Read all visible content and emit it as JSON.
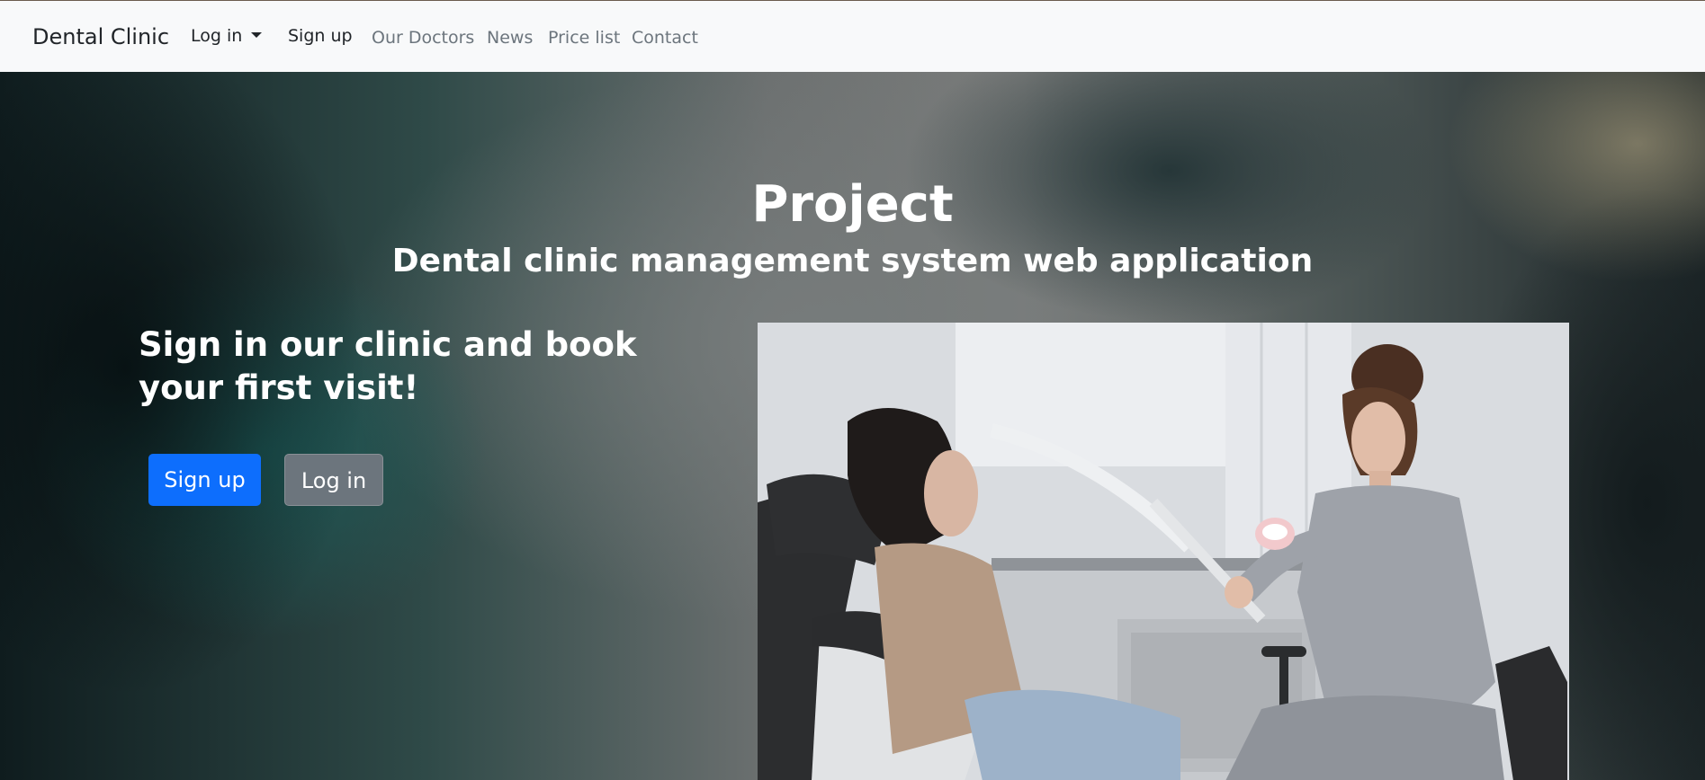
{
  "navbar": {
    "brand": "Dental Clinic",
    "login_label": "Log in",
    "signup_label": "Sign up",
    "links": [
      "Our Doctors",
      "News",
      "Price list",
      "Contact"
    ]
  },
  "hero": {
    "title": "Project",
    "subtitle": "Dental clinic management system web application",
    "cta_text": "Sign in our clinic and book your first visit!",
    "signup_button": "Sign up",
    "login_button": "Log in"
  },
  "colors": {
    "navbar_bg": "#f8f9fa",
    "primary": "#0d6efd",
    "secondary": "#6c757d"
  }
}
